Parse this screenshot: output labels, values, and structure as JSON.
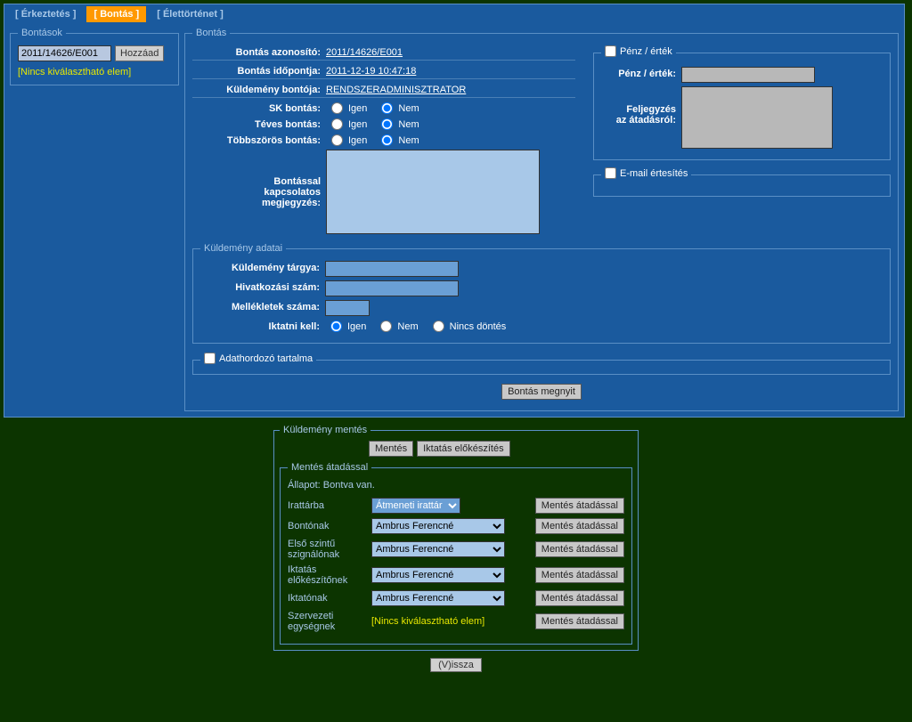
{
  "tabs": {
    "erkeztetes": "[ Érkeztetés ]",
    "bontas": "[ Bontás ]",
    "elettortenet": "[ Élettörténet ]"
  },
  "bontasok": {
    "legend": "Bontások",
    "input_value": "2011/14626/E001",
    "add_btn": "Hozzáad",
    "no_elem": "[Nincs kiválasztható elem]"
  },
  "bontas": {
    "legend": "Bontás",
    "azon_lbl": "Bontás azonosító:",
    "azon_val": "2011/14626/E001",
    "ido_lbl": "Bontás időpontja:",
    "ido_val": "2011-12-19 10:47:18",
    "bonto_lbl": "Küldemény bontója:",
    "bonto_val": "RENDSZERADMINISZTRATOR",
    "sk_lbl": "SK bontás:",
    "teves_lbl": "Téves bontás:",
    "tobb_lbl": "Többszörös bontás:",
    "igen": "Igen",
    "nem": "Nem",
    "megj_lbl1": "Bontással",
    "megj_lbl2": "kapcsolatos",
    "megj_lbl3": "megjegyzés:"
  },
  "penz": {
    "legend": "Pénz / érték",
    "lbl": "Pénz / érték:",
    "felj_lbl1": "Feljegyzés",
    "felj_lbl2": "az átadásról:"
  },
  "email": {
    "legend": "E-mail értesítés"
  },
  "kuld": {
    "legend": "Küldemény adatai",
    "targy_lbl": "Küldemény tárgya:",
    "hiv_lbl": "Hivatkozási szám:",
    "mell_lbl": "Mellékletek száma:",
    "ikt_lbl": "Iktatni kell:",
    "igen": "Igen",
    "nem": "Nem",
    "nincs": "Nincs döntés"
  },
  "adat": {
    "legend": "Adathordozó tartalma"
  },
  "megnyit_btn": "Bontás megnyit",
  "save": {
    "legend": "Küldemény mentés",
    "mentes_btn": "Mentés",
    "iktatas_btn": "Iktatás előkészítés",
    "atad_legend": "Mentés átadással",
    "allapot": "Állapot: Bontva van.",
    "rows": {
      "irattarba": "Irattárba",
      "bontonak": "Bontónak",
      "elso1": "Első szintű",
      "elso2": "szignálónak",
      "iktatas1": "Iktatás",
      "iktatas2": "előkészítőnek",
      "iktatonak": "Iktatónak",
      "szerv1": "Szervezeti",
      "szerv2": "egységnek"
    },
    "opts": {
      "atmeneti": "Átmeneti irattár",
      "ambrus": "Ambrus Ferencné"
    },
    "mentes_atad_btn": "Mentés átadással",
    "no_elem": "[Nincs kiválasztható elem]"
  },
  "vissza": "(V)issza"
}
